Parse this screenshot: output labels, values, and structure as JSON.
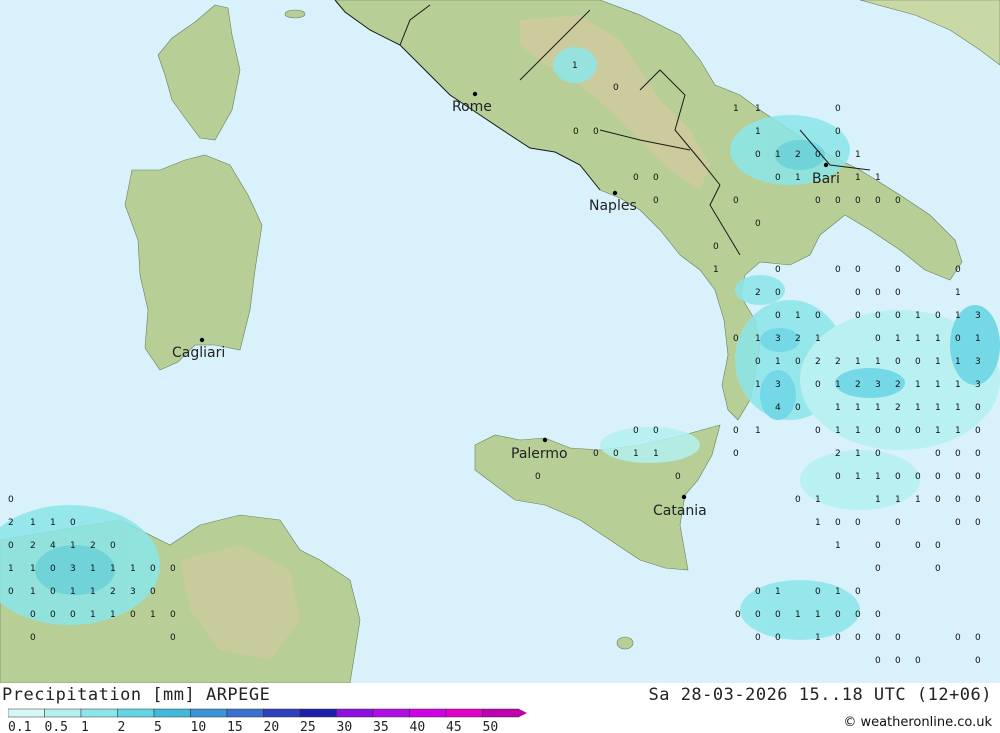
{
  "legend": {
    "title": "Precipitation [mm] ARPEGE",
    "valid_time": "Sa 28-03-2026 15..18 UTC (12+06)",
    "credit": "© weatheronline.co.uk",
    "classes": [
      "0.1",
      "0.5",
      "1",
      "2",
      "5",
      "10",
      "15",
      "20",
      "25",
      "30",
      "35",
      "40",
      "45",
      "50"
    ],
    "colors": [
      "#d6f7f7",
      "#b4f0f0",
      "#8be6ea",
      "#63d4e4",
      "#41b9dc",
      "#3c94d8",
      "#3b6fd0",
      "#2e3fc0",
      "#1d20a8",
      "#8d10e0",
      "#b00ee6",
      "#d000e6",
      "#e000c8",
      "#c000b0"
    ]
  },
  "colors": {
    "sea": "#d8f1fb",
    "land": "#b7cf96",
    "land_high": "#d4c9a0",
    "border": "#1a1a1a"
  },
  "cities": [
    {
      "name": "Rome"
    },
    {
      "name": "Naples"
    },
    {
      "name": "Bari"
    },
    {
      "name": "Cagliari"
    },
    {
      "name": "Palermo"
    },
    {
      "name": "Catania"
    }
  ],
  "values": [
    "0",
    "1",
    "0",
    "1",
    "2",
    "3",
    "4",
    "0",
    "1",
    "1",
    "0",
    "0",
    "0"
  ]
}
